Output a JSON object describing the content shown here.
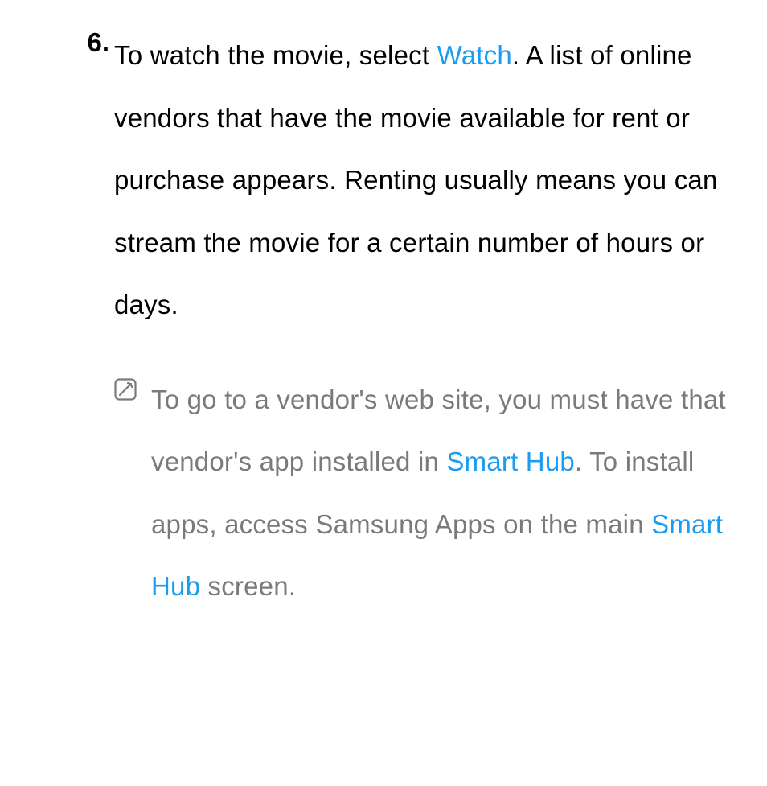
{
  "step": {
    "number": "6.",
    "text_before_watch": "To watch the movie, select ",
    "watch_label": "Watch",
    "text_after_watch": ". A list of online vendors that have the movie available for rent or purchase appears. Renting usually means you can stream the movie for a certain number of hours or days."
  },
  "note": {
    "icon_name": "note-icon",
    "seg1": "To go to a vendor's web site, you must have that vendor's app installed in ",
    "link1": "Smart Hub",
    "seg2": ". To install apps, access Samsung Apps on the main ",
    "link2": "Smart Hub",
    "seg3": " screen."
  },
  "colors": {
    "accent": "#1b9cf0",
    "body": "#000000",
    "muted": "#7a7a7a"
  }
}
